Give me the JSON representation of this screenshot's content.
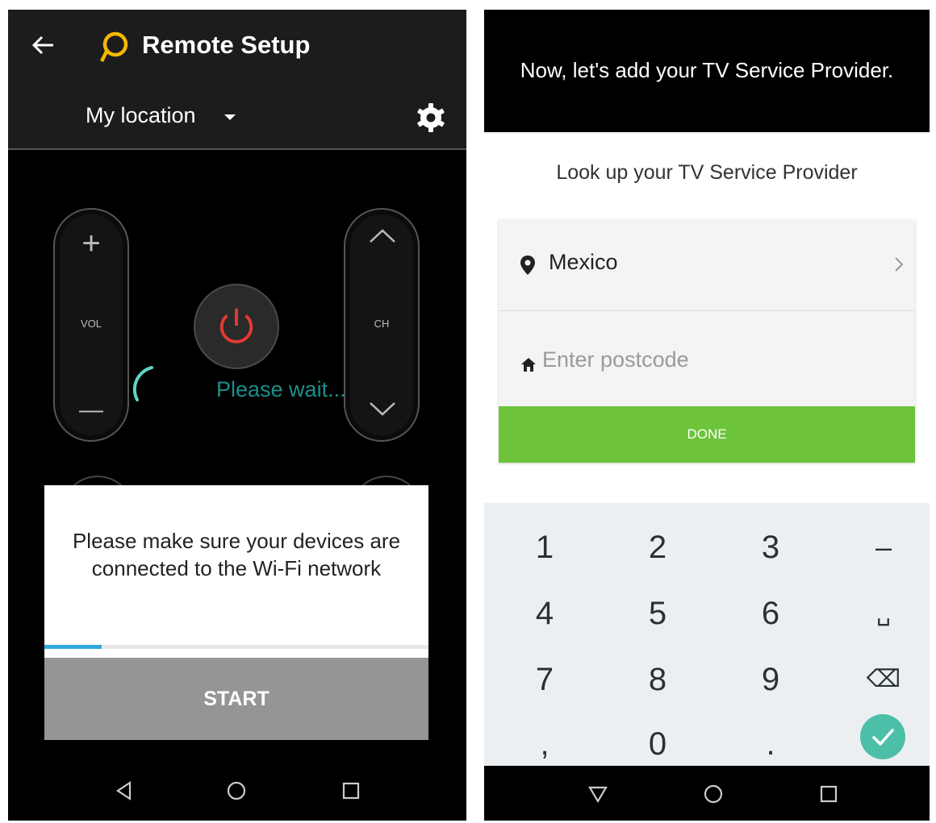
{
  "left_screen": {
    "app_title": "Remote Setup",
    "location_label": "My location",
    "remote": {
      "vol_plus": "+",
      "vol_label": "VOL",
      "vol_minus": "—",
      "ch_label": "CH",
      "wait_text": "Please wait..."
    },
    "dialog": {
      "message_line1": "Please make sure your devices are",
      "message_line2": "connected to the Wi-Fi network",
      "progress_percent": 15,
      "start_label": "START"
    },
    "icons": [
      "back-arrow-icon",
      "app-logo-icon",
      "dropdown-caret-icon",
      "gear-icon",
      "power-icon",
      "chevron-up-icon",
      "chevron-down-icon",
      "nav-back-icon",
      "nav-home-icon",
      "nav-recents-icon"
    ],
    "colors": {
      "bar": "#1c1c1c",
      "accent_logo": "#f5b800",
      "power": "#e53935",
      "wait": "#1a8f8a",
      "progress": "#30a8e0"
    }
  },
  "right_screen": {
    "header_text": "Now, let's add your TV Service Provider.",
    "lookup_title": "Look up your TV Service Provider",
    "country": "Mexico",
    "postcode_placeholder": "Enter postcode",
    "postcode_value": "",
    "done_label": "DONE",
    "keyboard": {
      "row1": [
        "1",
        "2",
        "3",
        "–"
      ],
      "row2": [
        "4",
        "5",
        "6",
        "␣"
      ],
      "row3": [
        "7",
        "8",
        "9",
        "⌫"
      ],
      "row4": [
        ",",
        "0",
        ".",
        "✓"
      ]
    },
    "colors": {
      "done": "#6dc43b",
      "ok_key": "#4dbfa8"
    }
  }
}
